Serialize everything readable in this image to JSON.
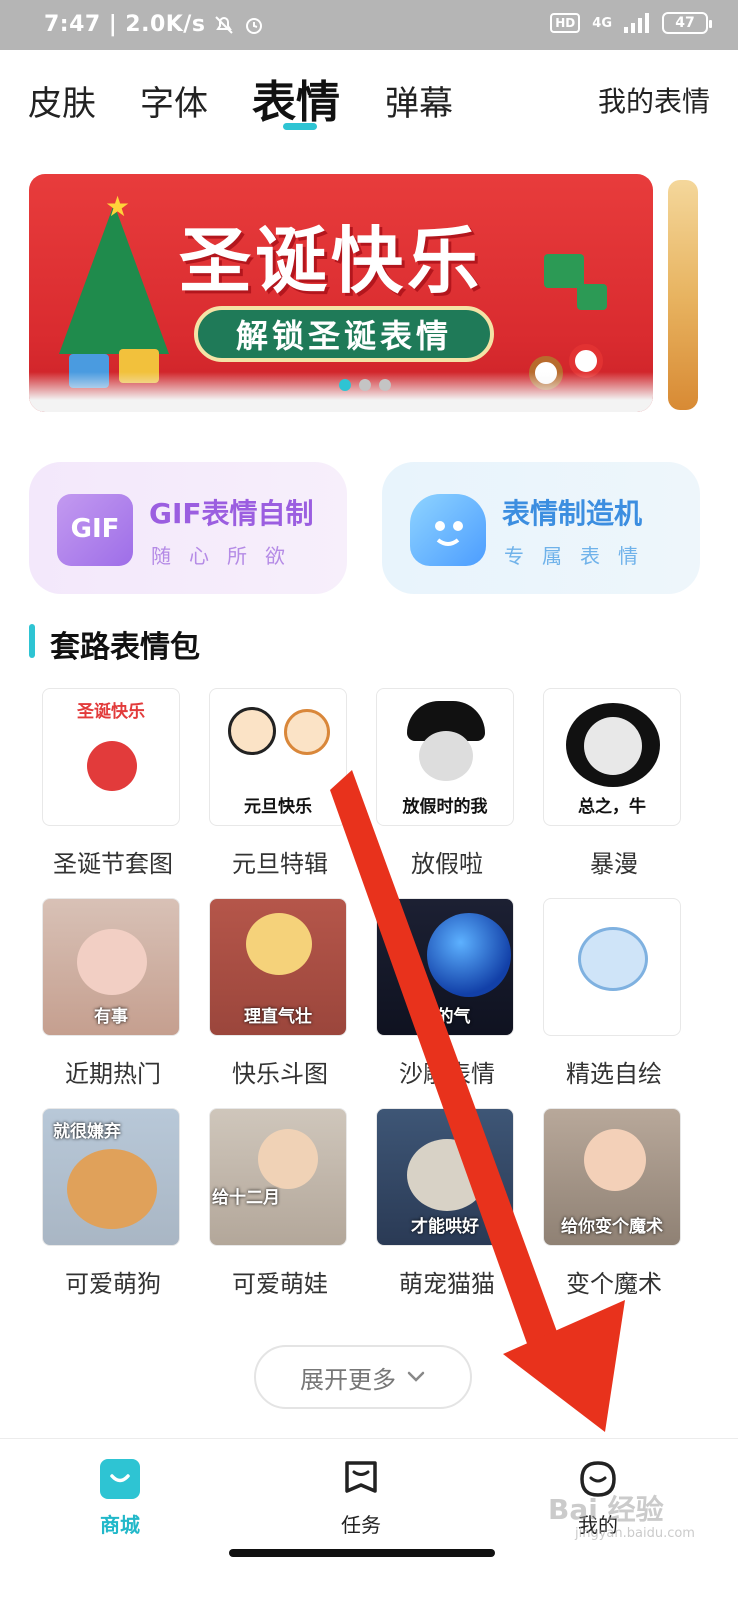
{
  "status_bar": {
    "time": "7:47",
    "speed": "2.0K/s",
    "hd": "HD",
    "network": "4G",
    "battery": "47"
  },
  "tabs": [
    {
      "label": "皮肤"
    },
    {
      "label": "字体"
    },
    {
      "label": "表情"
    },
    {
      "label": "弹幕"
    }
  ],
  "my_stickers_link": "我的表情",
  "banner": {
    "title": "圣诞快乐",
    "subtitle": "解锁圣诞表情"
  },
  "feature_cards": {
    "gif": {
      "icon_text": "GIF",
      "title": "GIF表情自制",
      "subtitle": "随心所欲"
    },
    "maker": {
      "title": "表情制造机",
      "subtitle": "专属表情"
    }
  },
  "section": {
    "title": "套路表情包"
  },
  "packs": [
    {
      "label": "圣诞节套图",
      "caption": "圣诞快乐"
    },
    {
      "label": "元旦特辑",
      "caption": "元旦快乐"
    },
    {
      "label": "放假啦",
      "caption": "放假时的我"
    },
    {
      "label": "暴漫",
      "caption": "总之，牛"
    },
    {
      "label": "近期热门",
      "caption": "有事"
    },
    {
      "label": "快乐斗图",
      "caption": "理直气壮"
    },
    {
      "label": "沙雕表情",
      "caption": "我的气"
    },
    {
      "label": "精选自绘",
      "caption": ""
    },
    {
      "label": "可爱萌狗",
      "caption": "就很嫌弃"
    },
    {
      "label": "可爱萌娃",
      "caption": "给十二月"
    },
    {
      "label": "萌宠猫猫",
      "caption": "才能哄好"
    },
    {
      "label": "变个魔术",
      "caption": "给你变个魔术"
    }
  ],
  "expand_button": "展开更多",
  "bottom_nav": [
    {
      "label": "商城"
    },
    {
      "label": "任务"
    },
    {
      "label": "我的"
    }
  ],
  "watermark": {
    "text": "Bai 经验",
    "sub": "jingyan.baidu.com"
  },
  "colors": {
    "accent": "#2ec4d3",
    "banner_red": "#e83c3c",
    "arrow_red": "#e8321c"
  }
}
